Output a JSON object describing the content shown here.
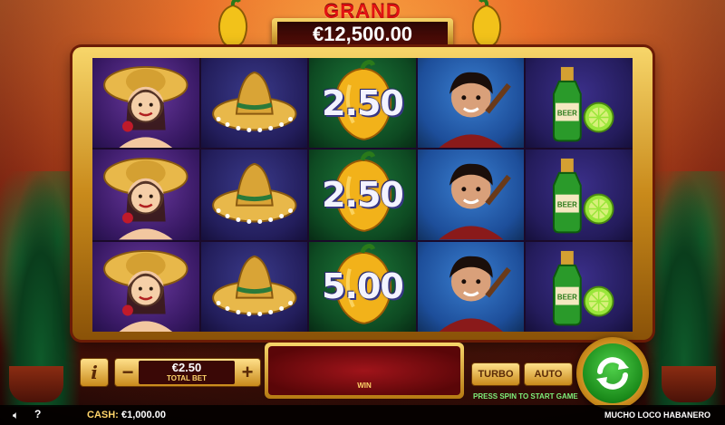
{
  "jackpot": {
    "label": "GRAND",
    "amount": "€12,500.00"
  },
  "reels": [
    {
      "style": "purple",
      "symbols": [
        "senorita",
        "senorita",
        "senorita"
      ]
    },
    {
      "style": "blue-dark",
      "symbols": [
        "sombrero",
        "sombrero",
        "sombrero"
      ]
    },
    {
      "style": "green",
      "symbols": [
        "chili",
        "chili",
        "chili"
      ],
      "values": [
        "2.50",
        "2.50",
        "5.00"
      ]
    },
    {
      "style": "blue",
      "symbols": [
        "guitarist",
        "guitarist",
        "guitarist"
      ]
    },
    {
      "style": "indigo",
      "symbols": [
        "beer",
        "beer",
        "beer"
      ]
    }
  ],
  "bet": {
    "value": "€2.50",
    "label": "TOTAL BET",
    "minus": "−",
    "plus": "+",
    "info": "i"
  },
  "win": {
    "label": "WIN"
  },
  "buttons": {
    "turbo": "TURBO",
    "auto": "AUTO"
  },
  "hint": "PRESS SPIN TO START GAME",
  "footer": {
    "cash_label": "CASH:",
    "cash_value": "€1,000.00",
    "game_title": "MUCHO LOCO HABANERO",
    "help": "?"
  },
  "colors": {
    "grand_red": "#e31212",
    "gold": "#f7d66a",
    "spin_green": "#1a8a1a"
  }
}
